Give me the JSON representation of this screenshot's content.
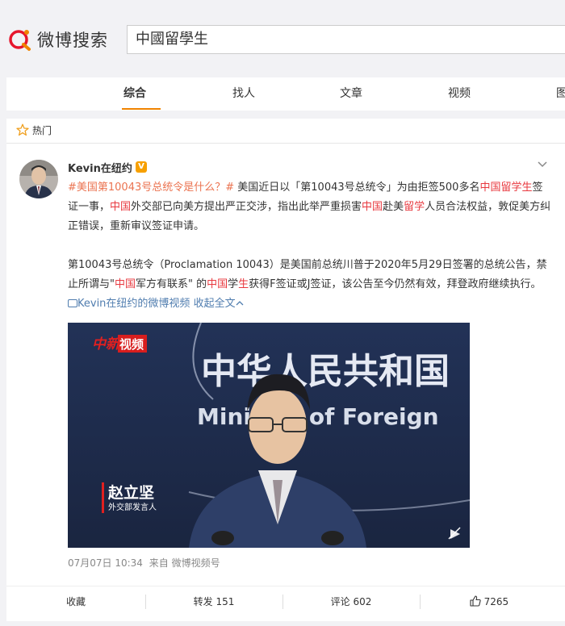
{
  "logo": {
    "text": "微博搜索"
  },
  "search": {
    "value": "中國留學生"
  },
  "tabs": [
    {
      "label": "综合"
    },
    {
      "label": "找人"
    },
    {
      "label": "文章"
    },
    {
      "label": "视频"
    },
    {
      "label": "图"
    }
  ],
  "hot": {
    "label": "热门"
  },
  "post": {
    "username": "Kevin在纽约",
    "verified": "V",
    "text1": {
      "tag": "#美国第10043号总统令是什么？#",
      "s1": " 美国近日以「第10043号总统令」为由拒签500多名",
      "k1": "中国留学生",
      "s2": "签证一事，",
      "k2": "中国",
      "s3": "外交部已向美方提出严正交涉，指出此举严重损害",
      "k3": "中国",
      "s4": "赴美",
      "k4": "留学",
      "s5": "人员合法权益，敦促美方纠正错误，重新审议签证申请。"
    },
    "text2": {
      "s1": "第10043号总统令（Proclamation 10043）是美国前总统川普于2020年5月29日签署的总统公告，禁止所谓与\"",
      "k1": "中国",
      "s2": "军方有联系\" 的",
      "k2": "中国",
      "s3": "学",
      "k3": "生",
      "s4": "获得F签证或J签证，该公告至今仍然有效，拜登政府继续执行。",
      "video_link": "Kevin在纽约的微博视频",
      "expand": "收起全文"
    },
    "video": {
      "watermark": "视频",
      "watermark_prefix": "中新",
      "bg_text_cn": "中华人民共和国",
      "bg_text_en": "Ministry of Foreign",
      "caption_name": "赵立坚",
      "caption_title": "外交部发言人"
    },
    "meta": {
      "time": "07月07日 10:34",
      "source": "来自 微博视频号"
    },
    "actions": {
      "collect": "收藏",
      "repost": "转发 151",
      "comment": "评论 602",
      "like": "7265"
    }
  },
  "colors": {
    "accent": "#f08300",
    "keyword": "#e8393f",
    "tag": "#eb7350",
    "link": "#507daf"
  }
}
